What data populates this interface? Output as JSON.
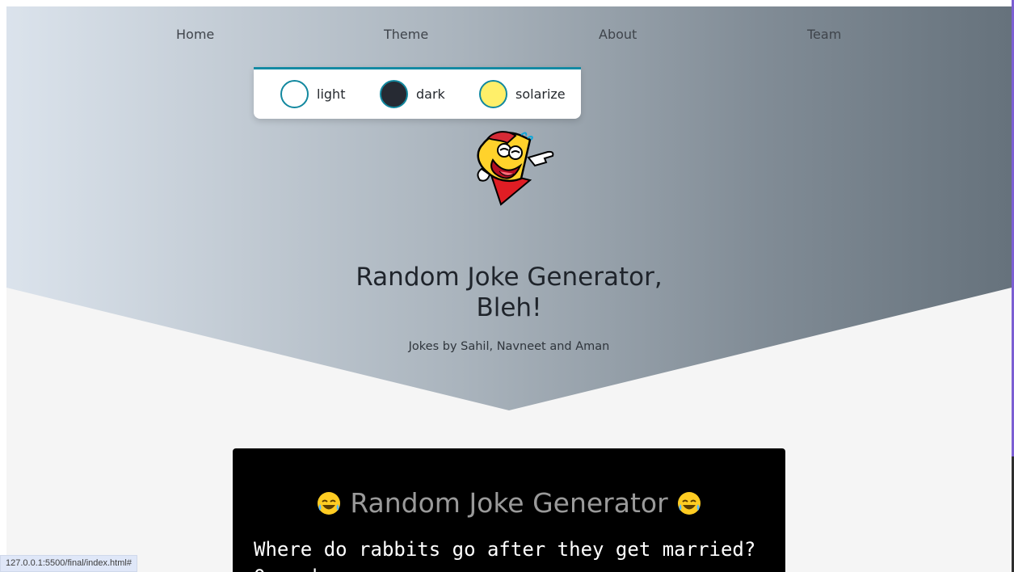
{
  "nav": {
    "items": [
      {
        "label": "Home"
      },
      {
        "label": "Theme"
      },
      {
        "label": "About"
      },
      {
        "label": "Team"
      }
    ]
  },
  "theme_menu": {
    "options": [
      {
        "label": "light",
        "color": "#ffffff"
      },
      {
        "label": "dark",
        "color": "#262a33"
      },
      {
        "label": "solarize",
        "color": "#ffef69"
      }
    ]
  },
  "hero": {
    "title": "Random Joke Generator,\nBleh!",
    "subtitle": "Jokes by Sahil, Navneet and Aman"
  },
  "joke_card": {
    "heading": "Random Joke Generator",
    "emoji_icon": "face-with-tears-of-joy-icon",
    "joke_text": "Where do rabbits go after they get married? On a bunny moon."
  },
  "status_bar": {
    "url": "127.0.0.1:5500/final/index.html#"
  },
  "colors": {
    "accent": "#148aa3",
    "frame": "#7c5fd3",
    "card": "#000000"
  }
}
